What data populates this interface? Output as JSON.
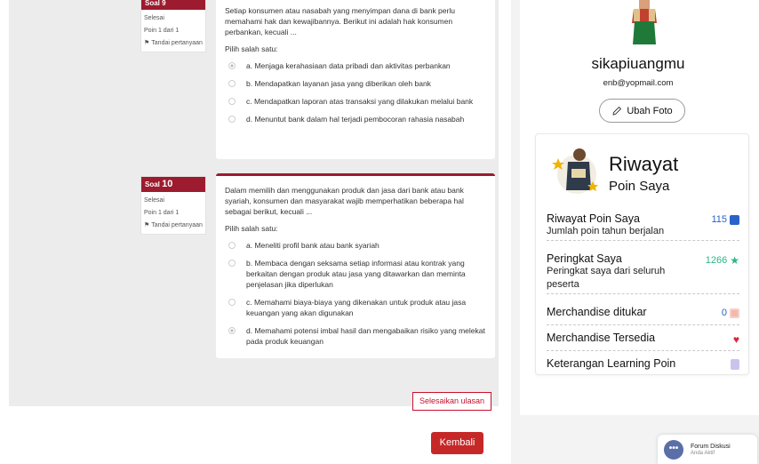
{
  "questions": [
    {
      "soal_label": "Soal 9",
      "status": "Selesai",
      "points": "Poin 1 dari 1",
      "flag_label": "Tandai pertanyaan",
      "question": "Setiap konsumen atau nasabah yang menyimpan dana di bank perlu memahami hak dan kewajibannya. Berikut ini adalah hak konsumen perbankan, kecuali ...",
      "pick": "Pilih salah satu:",
      "options": [
        "a. Menjaga kerahasiaan data pribadi dan aktivitas perbankan",
        "b. Mendapatkan layanan jasa yang diberikan oleh bank",
        "c. Mendapatkan laporan atas transaksi yang dilakukan melalui bank",
        "d. Menuntut bank dalam hal terjadi pembocoran rahasia nasabah"
      ],
      "selected_index": 0
    },
    {
      "soal_word": "Soal",
      "soal_num": "10",
      "status": "Selesai",
      "points": "Poin 1 dari 1",
      "flag_label": "Tandai pertanyaan",
      "question": "Dalam memilih dan menggunakan produk dan jasa dari bank atau bank syariah, konsumen dan masyarakat wajib memperhatikan beberapa hal sebagai berikut, kecuali ...",
      "pick": "Pilih salah satu:",
      "options": [
        "a. Meneliti profil bank atau bank syariah",
        "b. Membaca dengan seksama setiap informasi atau kontrak yang berkaitan dengan produk atau jasa yang ditawarkan dan meminta penjelasan jika diperlukan",
        "c. Memahami biaya-biaya yang dikenakan untuk produk atau jasa keuangan yang akan digunakan",
        "d. Memahami potensi imbal hasil dan mengabaikan risiko yang melekat pada produk keuangan"
      ],
      "selected_index": 3
    }
  ],
  "finish_review": "Selesaikan ulasan",
  "back_button": "Kembali",
  "profile": {
    "username": "sikapiuangmu",
    "email": "enb@yopmail.com",
    "change_photo": "Ubah Foto"
  },
  "riwayat": {
    "title": "Riwayat",
    "subtitle": "Poin Saya",
    "items": [
      {
        "label": "Riwayat Poin Saya",
        "desc": "Jumlah poin tahun berjalan",
        "value": "115",
        "icon": "chart-icon",
        "color": "#2a62c9"
      },
      {
        "label": "Peringkat Saya",
        "desc": "Peringkat saya dari seluruh peserta",
        "value": "1266",
        "icon": "star-icon",
        "color": "#2bb58a"
      },
      {
        "label": "Merchandise ditukar",
        "desc": "",
        "value": "0",
        "icon": "gift-icon",
        "color": "#e8574a"
      },
      {
        "label": "Merchandise Tersedia",
        "desc": "",
        "value": "",
        "icon": "heart-icon",
        "color": "#d6263b"
      },
      {
        "label": "Keterangan Learning Poin",
        "desc": "",
        "value": "",
        "icon": "document-icon",
        "color": "#8a83c9"
      }
    ]
  },
  "forum": {
    "title": "Forum Diskusi",
    "status": "Anda Aktif",
    "icon": "chat-bubble-icon"
  },
  "colors": {
    "brand_maroon": "#9d1b2e",
    "button_red": "#c62828",
    "accent_blue": "#2a62c9",
    "accent_green": "#2bb58a"
  }
}
